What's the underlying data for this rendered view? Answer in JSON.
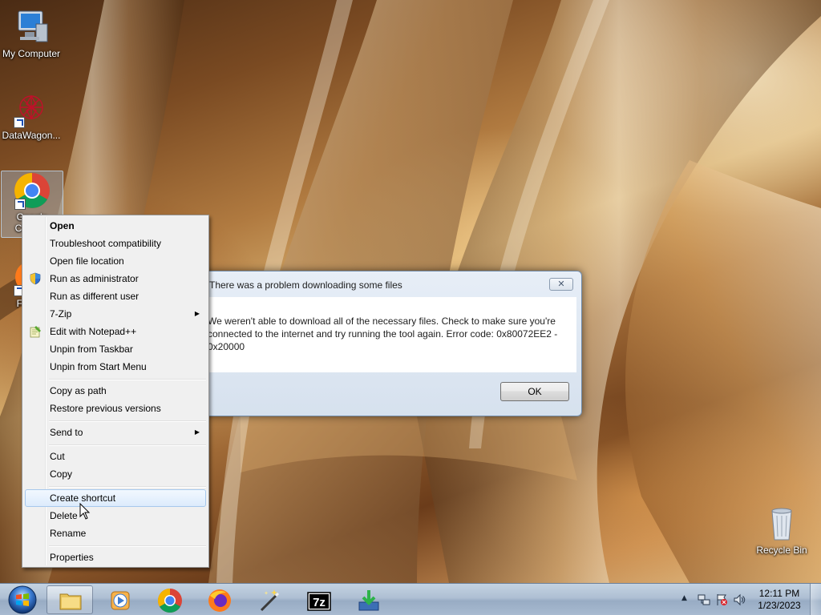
{
  "desktop": {
    "icons": [
      {
        "name": "my-computer",
        "label": "My Computer"
      },
      {
        "name": "datawagon",
        "label": "DataWagon..."
      },
      {
        "name": "google-chrome",
        "label": "Google Chrome"
      },
      {
        "name": "firefox",
        "label": "Firefox"
      },
      {
        "name": "recycle-bin",
        "label": "Recycle Bin"
      }
    ]
  },
  "dialog": {
    "title": "There was a problem downloading some files",
    "message": "We weren't able to download all of the necessary files. Check to make sure you're\nconnected to the internet and try running the tool again. Error code: 0x80072EE2 -\n0x20000",
    "close_label": "✕",
    "ok_label": "OK"
  },
  "context_menu": {
    "items": [
      {
        "label": "Open",
        "bold": true
      },
      {
        "label": "Troubleshoot compatibility"
      },
      {
        "label": "Open file location"
      },
      {
        "label": "Run as administrator",
        "icon": "uac-shield-icon"
      },
      {
        "label": "Run as different user"
      },
      {
        "label": "7-Zip",
        "submenu": true
      },
      {
        "label": "Edit with Notepad++",
        "icon": "notepad-plus-plus-icon"
      },
      {
        "label": "Unpin from Taskbar"
      },
      {
        "label": "Unpin from Start Menu"
      },
      {
        "label": "Copy as path"
      },
      {
        "label": "Restore previous versions"
      },
      {
        "label": "Send to",
        "submenu": true
      },
      {
        "label": "Cut"
      },
      {
        "label": "Copy"
      },
      {
        "label": "Create shortcut",
        "highlighted": true
      },
      {
        "label": "Delete"
      },
      {
        "label": "Rename"
      },
      {
        "label": "Properties"
      }
    ],
    "submenu_arrow": "▶"
  },
  "taskbar": {
    "buttons": [
      {
        "name": "windows-explorer",
        "icon": "folder-icon",
        "active": true
      },
      {
        "name": "windows-media-player",
        "icon": "media-player-icon"
      },
      {
        "name": "google-chrome",
        "icon": "chrome-icon"
      },
      {
        "name": "firefox",
        "icon": "firefox-icon"
      },
      {
        "name": "magic-wand-app",
        "icon": "magic-wand-icon"
      },
      {
        "name": "7-zip",
        "icon": "7zip-icon",
        "text": "7z"
      },
      {
        "name": "download-tool",
        "icon": "download-arrow-icon"
      }
    ],
    "tray": {
      "time": "12:11 PM",
      "date": "1/23/2023",
      "icons": [
        "show-hidden-icons-arrow",
        "network-icon",
        "action-center-flag-icon",
        "volume-icon"
      ]
    }
  },
  "colors": {
    "taskbar": "#a8bad0",
    "menu_background": "#f0f0f0",
    "menu_highlight": "#dcebfc",
    "dialog_frame": "#d6e1ee"
  }
}
